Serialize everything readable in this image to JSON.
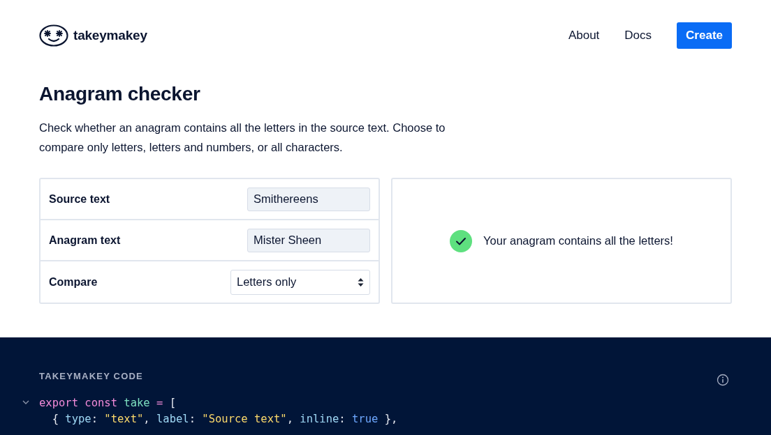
{
  "brand": {
    "name": "takeymakey"
  },
  "nav": [
    {
      "label": "About",
      "kind": "link"
    },
    {
      "label": "Docs",
      "kind": "link"
    },
    {
      "label": "Create",
      "kind": "button"
    }
  ],
  "title": "Anagram checker",
  "description": "Check whether an anagram contains all the letters in the source text. Choose to compare only letters, letters and numbers, or all characters.",
  "fields": [
    {
      "label": "Source text",
      "kind": "text",
      "value": "Smithereens"
    },
    {
      "label": "Anagram text",
      "kind": "text",
      "value": "Mister Sheen"
    },
    {
      "label": "Compare",
      "kind": "select",
      "value": "Letters only"
    }
  ],
  "result": {
    "kind": "success",
    "message": "Your anagram contains all the letters!"
  },
  "code": {
    "heading": "TAKEYMAKEY CODE",
    "expanded": true,
    "lines": [
      [
        {
          "kind": "keyword",
          "text": "export const"
        },
        {
          "kind": "name",
          "text": " take"
        },
        {
          "kind": "operator",
          "text": " ="
        },
        {
          "kind": "punct",
          "text": " ["
        }
      ],
      [
        {
          "kind": "punct",
          "text": "  { "
        },
        {
          "kind": "key",
          "text": "type"
        },
        {
          "kind": "punct",
          "text": ": "
        },
        {
          "kind": "string",
          "text": "\"text\""
        },
        {
          "kind": "punct",
          "text": ", "
        },
        {
          "kind": "key",
          "text": "label"
        },
        {
          "kind": "punct",
          "text": ": "
        },
        {
          "kind": "string",
          "text": "\"Source text\""
        },
        {
          "kind": "punct",
          "text": ", "
        },
        {
          "kind": "key",
          "text": "inline"
        },
        {
          "kind": "punct",
          "text": ": "
        },
        {
          "kind": "bool",
          "text": "true"
        },
        {
          "kind": "punct",
          "text": " },"
        }
      ]
    ]
  }
}
